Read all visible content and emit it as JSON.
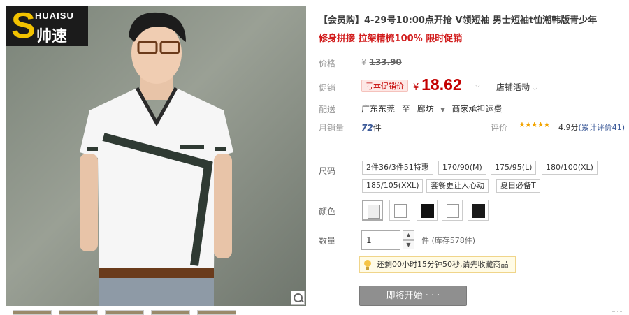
{
  "brand": {
    "logo_letter": "S",
    "name_en": "HUAISU",
    "name_cn": "帅速"
  },
  "product": {
    "title": "【会员购】4-29号10:00点开抢 V领短袖 男士短袖t恤潮韩版青少年",
    "subtitle": "修身拼接 拉架精梳100% 限时促销"
  },
  "price": {
    "label": "价格",
    "currency": "¥",
    "original": "133.90",
    "promo_label": "促销",
    "promo_tag": "亏本促销价",
    "promo_value": "18.62",
    "store_activity": "店铺活动"
  },
  "shipping": {
    "label": "配送",
    "from": "广东东莞",
    "to_word": "至",
    "destination": "廊坊",
    "fee": "商家承担运费"
  },
  "sales": {
    "label": "月销量",
    "count": "72",
    "unit": "件",
    "rating_label": "评价",
    "stars": "★★★★★",
    "score": "4.9分",
    "total_reviews": "(累计评价41)"
  },
  "size": {
    "label": "尺码",
    "options": [
      "2件36/3件51特惠",
      "170/90(M)",
      "175/95(L)",
      "180/100(XL)",
      "185/105(XXL)",
      "套餐更让人心动",
      "夏日必备T"
    ]
  },
  "color": {
    "label": "颜色",
    "swatch_colors": [
      "#f4f4f4",
      "#ffffff",
      "#111111",
      "#ffffff",
      "#1a1a1a"
    ]
  },
  "quantity": {
    "label": "数量",
    "value": "1",
    "unit_text": "件 (库存578件)"
  },
  "notice": {
    "text": "还剩00小时15分钟50秒,请先收藏商品"
  },
  "buy_button": {
    "label": "即将开始 · · ·"
  }
}
